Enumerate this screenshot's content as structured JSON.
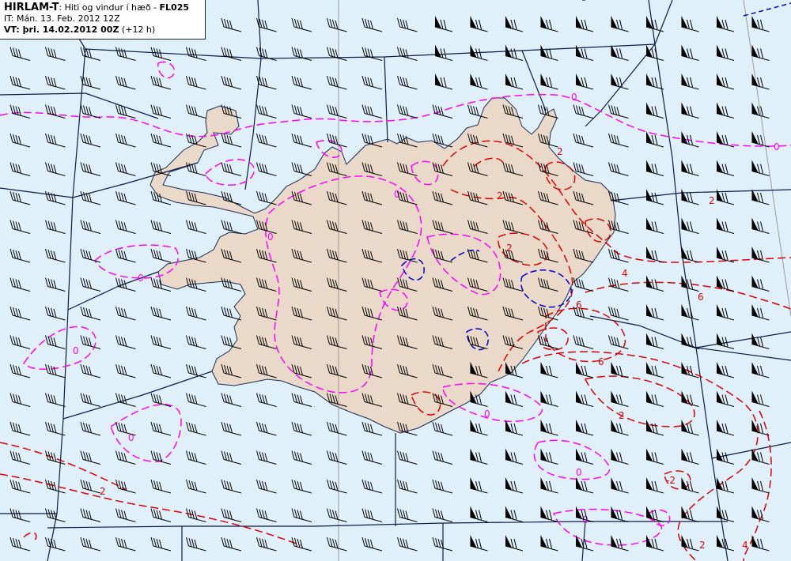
{
  "info_box": {
    "model": "HIRLAM-T",
    "subtitle": ": Hiti og vindur í hæð - ",
    "level": "FL025",
    "it_line": "IT: Mán. 13. Feb. 2012 12Z",
    "vt_label": "VT: þri. 14.02.2012 00Z",
    "vt_offset": " (+12 h)"
  },
  "contour_labels": {
    "zero": "0",
    "minus2": "-2",
    "plus2": "2",
    "plus4": "4",
    "plus6": "6",
    "neg2b": "2"
  },
  "colors": {
    "sea": "#e0f0fa",
    "land": "#ead9c8",
    "zero_isotherm": "#ff00ff",
    "warm_isotherm": "#dd0000",
    "cold_isotherm": "#0000cc",
    "grid": "#0a1a4a",
    "meridian": "#999999"
  }
}
